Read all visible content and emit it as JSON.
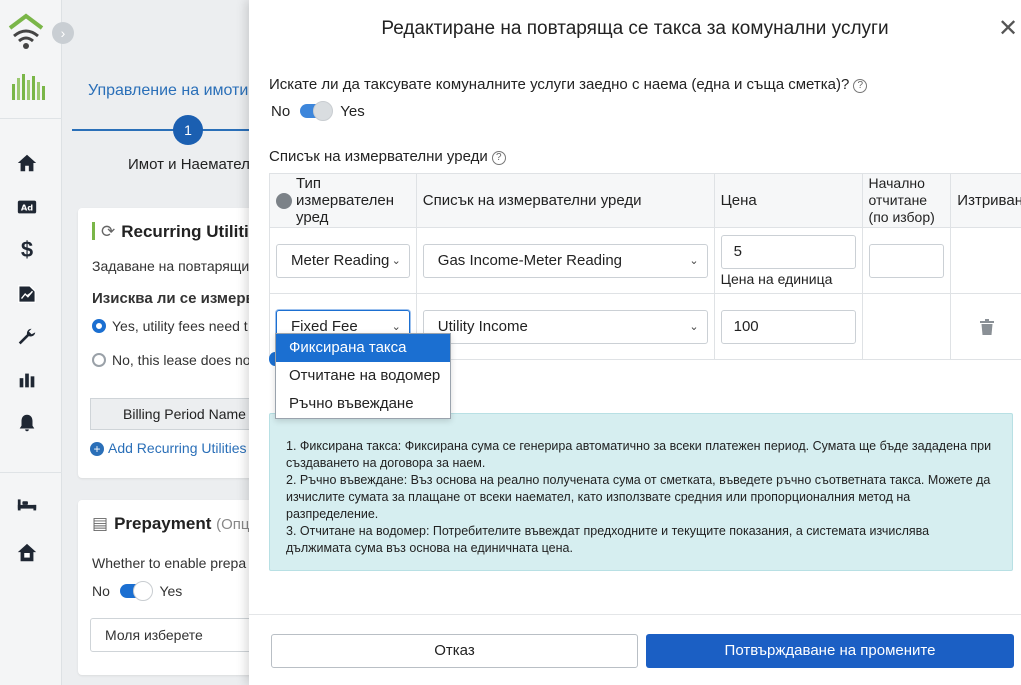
{
  "rail": {
    "icons": [
      "wifi-logo-icon",
      "collapse-arrow-icon",
      "brand-logo-icon",
      "home-icon",
      "ad-icon",
      "dollar-icon",
      "report-icon",
      "wrench-icon",
      "bar-chart-icon",
      "bell-icon",
      "bed-icon",
      "house-lock-icon"
    ],
    "ad_text": "Ad"
  },
  "background": {
    "title": "Управление на имоти",
    "step_number": "1",
    "step_label": "Имот и Наемател",
    "utilities_card": {
      "title": "Recurring Utilitie",
      "subtitle": "Задаване на повтарящи",
      "question": "Изисква ли се измерва",
      "option_yes": "Yes, utility fees need t",
      "option_no": "No, this lease does no",
      "billing_button": "Billing Period Name",
      "add_link": "Add Recurring Utilities"
    },
    "prepayment_card": {
      "title": "Prepayment",
      "title_suffix": "(Опци",
      "question": "Whether to enable prepa",
      "toggle_no": "No",
      "toggle_yes": "Yes",
      "select_placeholder": "Моля изберете"
    }
  },
  "dialog": {
    "title": "Редактиране на повтаряща се такса за комунални услуги",
    "close_symbol": "✕",
    "question": "Искате ли да таксувате комуналните услуги заедно с наема (една и съща сметка)?",
    "toggle_no": "No",
    "toggle_yes": "Yes",
    "meters_title": "Списък на измервателни уреди",
    "table": {
      "headers": {
        "type": "Тип измервателен уред",
        "list": "Списък на измервателни уреди",
        "price": "Цена",
        "initial": "Начално отчитане (по избор)",
        "delete": "Изтриван"
      },
      "rows": [
        {
          "type": "Meter Reading",
          "list": "Gas Income-Meter Reading",
          "price": "5",
          "price_note": "Цена на единица",
          "initial": ""
        },
        {
          "type": "Fixed Fee",
          "list": "Utility Income",
          "price": "100"
        }
      ]
    },
    "dropdown_options": [
      "Фиксирана такса",
      "Отчитане на водомер",
      "Ръчно въвеждане"
    ],
    "info": [
      "1. Фиксирана такса: Фиксирана сума се генерира автоматично за всеки платежен период. Сумата ще бъде зададена при създаването на договора за наем.",
      "2. Ръчно въвеждане: Въз основа на реално получената сума от сметката, въведете ръчно съответната такса. Можете да изчислите сумата за плащане от всеки наемател, като използвате средния или пропорционалния метод на разпределение.",
      "3. Отчитане на водомер: Потребителите въвеждат предходните и текущите показания, а системата изчислява дължимата сума въз основа на единичната цена."
    ],
    "cancel": "Отказ",
    "confirm": "Потвърждаване на промените"
  }
}
